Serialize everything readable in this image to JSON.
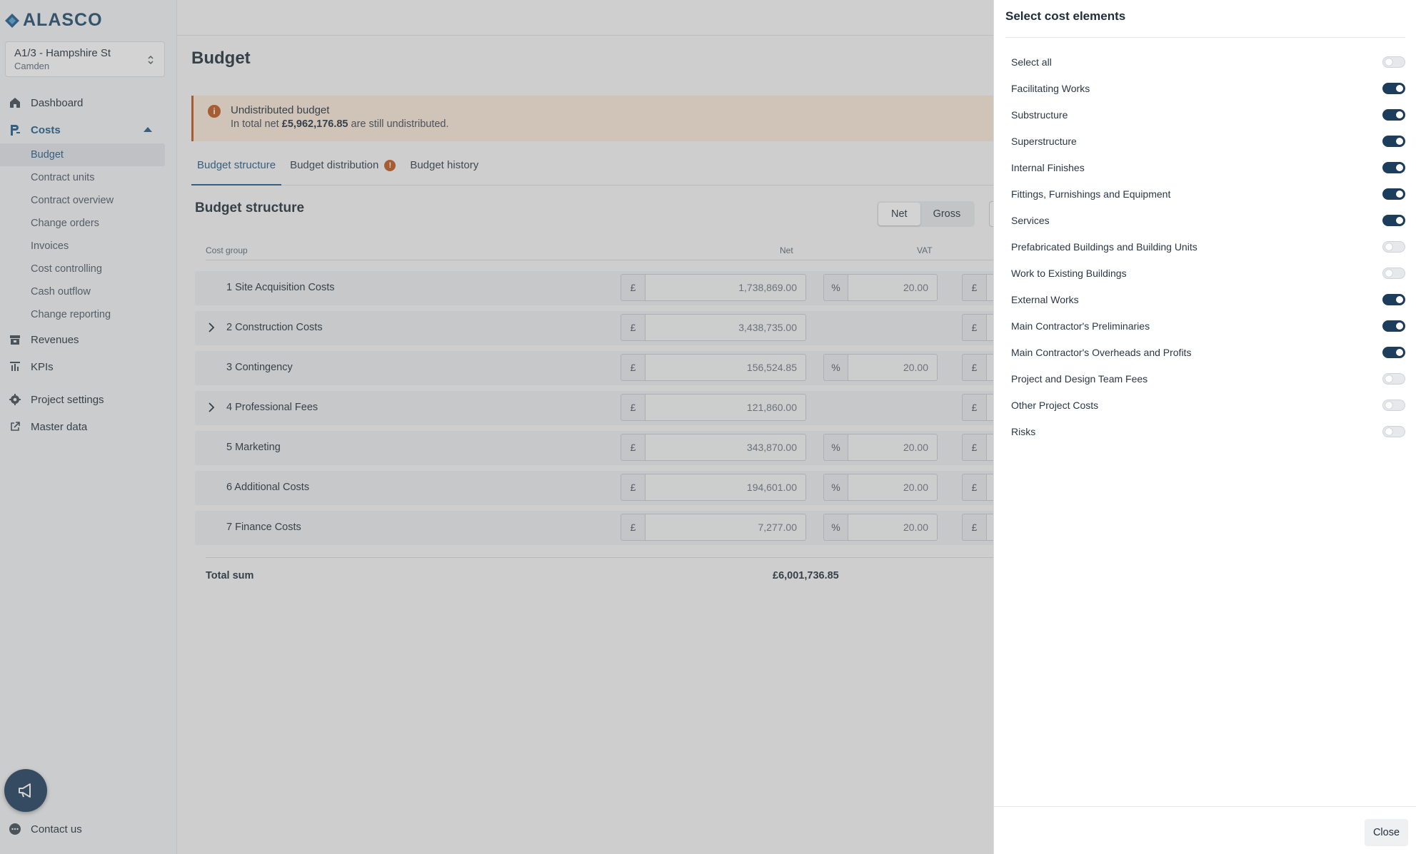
{
  "brand": {
    "name": "ALASCO",
    "accent": "#1d5a8a",
    "dark": "#1d3d5c",
    "warning": "#c0561a"
  },
  "project": {
    "name": "A1/3 - Hampshire St",
    "location": "Camden"
  },
  "nav": {
    "dashboard": "Dashboard",
    "costs": "Costs",
    "costs_items": [
      "Budget",
      "Contract units",
      "Contract overview",
      "Change orders",
      "Invoices",
      "Cost controlling",
      "Cash outflow",
      "Change reporting"
    ],
    "revenues": "Revenues",
    "kpis": "KPIs",
    "project_settings": "Project settings",
    "master_data": "Master data",
    "contact": "Contact us"
  },
  "page": {
    "title": "Budget"
  },
  "alert": {
    "title": "Undistributed budget",
    "prefix": "In total net",
    "amount": "£5,962,176.85",
    "suffix": "are still undistributed."
  },
  "tabs": [
    "Budget structure",
    "Budget distribution",
    "Budget history"
  ],
  "budget": {
    "section_title": "Budget structure",
    "toggle": {
      "net": "Net",
      "gross": "Gross",
      "selected": "Net"
    },
    "columns": {
      "group": "Cost group",
      "net": "Net",
      "vat": "VAT"
    },
    "currency": "£",
    "percent": "%",
    "rows": [
      {
        "label": "1 Site Acquisition Costs",
        "net": "1,738,869.00",
        "vat": "20.00",
        "expandable": false
      },
      {
        "label": "2 Construction Costs",
        "net": "3,438,735.00",
        "vat": "",
        "expandable": true
      },
      {
        "label": "3 Contingency",
        "net": "156,524.85",
        "vat": "20.00",
        "expandable": false
      },
      {
        "label": "4 Professional Fees",
        "net": "121,860.00",
        "vat": "",
        "expandable": true
      },
      {
        "label": "5 Marketing",
        "net": "343,870.00",
        "vat": "20.00",
        "expandable": false
      },
      {
        "label": "6 Additional Costs",
        "net": "194,601.00",
        "vat": "20.00",
        "expandable": false
      },
      {
        "label": "7 Finance Costs",
        "net": "7,277.00",
        "vat": "20.00",
        "expandable": false
      }
    ],
    "total_label": "Total sum",
    "total_value": "£6,001,736.85"
  },
  "panel": {
    "title": "Select cost elements",
    "options": [
      {
        "label": "Select all",
        "on": false
      },
      {
        "label": "Facilitating Works",
        "on": true
      },
      {
        "label": "Substructure",
        "on": true
      },
      {
        "label": "Superstructure",
        "on": true
      },
      {
        "label": "Internal Finishes",
        "on": true
      },
      {
        "label": "Fittings, Furnishings and Equipment",
        "on": true
      },
      {
        "label": "Services",
        "on": true
      },
      {
        "label": "Prefabricated Buildings and Building Units",
        "on": false
      },
      {
        "label": "Work to Existing Buildings",
        "on": false
      },
      {
        "label": "External Works",
        "on": true
      },
      {
        "label": "Main Contractor's Preliminaries",
        "on": true
      },
      {
        "label": "Main Contractor's Overheads and Profits",
        "on": true
      },
      {
        "label": "Project and Design Team Fees",
        "on": false
      },
      {
        "label": "Other Project Costs",
        "on": false
      },
      {
        "label": "Risks",
        "on": false
      }
    ],
    "close_label": "Close"
  }
}
